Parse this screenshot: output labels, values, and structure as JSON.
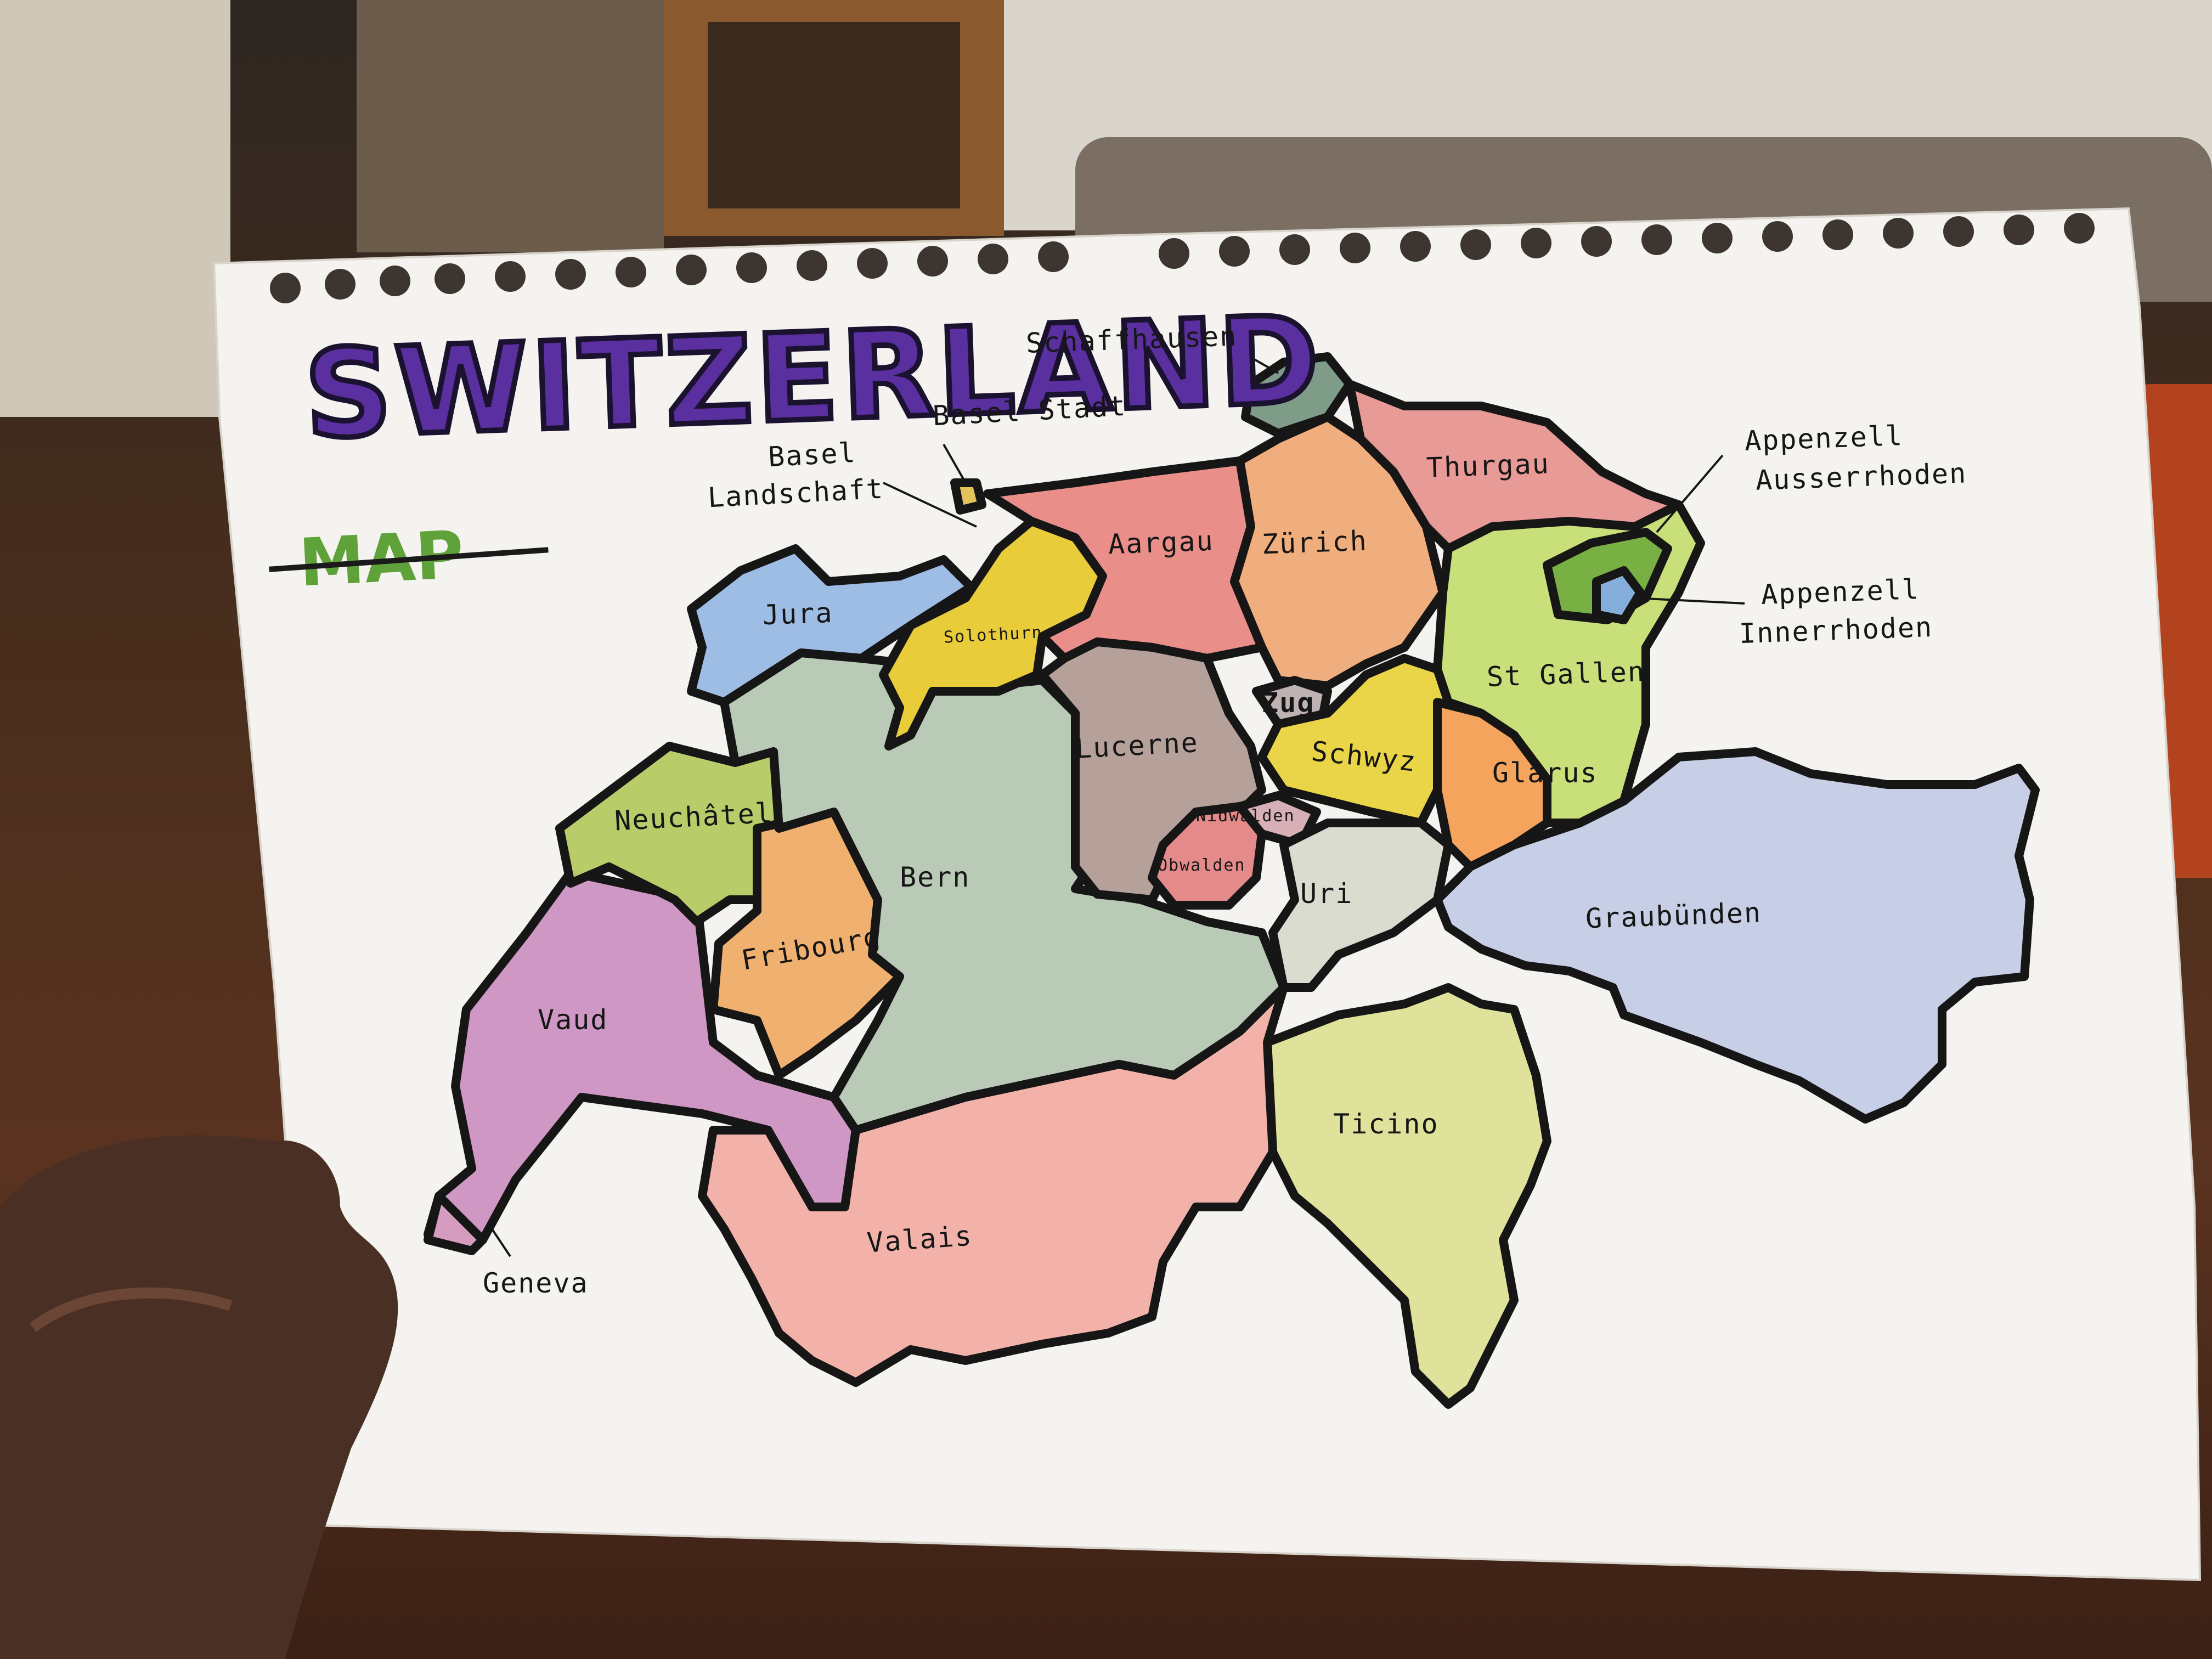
{
  "map": {
    "title": "SWITZERLAND",
    "subtitle": "MAP",
    "cantons": [
      {
        "name": "Schaffhausen",
        "color": "#7f9c88"
      },
      {
        "name": "Basel-Stadt",
        "color": "#e3c45a"
      },
      {
        "name": "Basel Landschaft",
        "color": "#e3c45a"
      },
      {
        "name": "Thurgau",
        "color": "#e79a96"
      },
      {
        "name": "Appenzell Ausserrhoden",
        "color": "#79b043"
      },
      {
        "name": "Appenzell Innerrhoden",
        "color": "#86aedd"
      },
      {
        "name": "Aargau",
        "color": "#e98e89"
      },
      {
        "name": "Zürich",
        "color": "#f0ad7e"
      },
      {
        "name": "Jura",
        "color": "#9ebde5"
      },
      {
        "name": "Solothurn",
        "color": "#e8cc3a"
      },
      {
        "name": "St Gallen",
        "color": "#c9e07a"
      },
      {
        "name": "Zug",
        "color": "#bfb2b3"
      },
      {
        "name": "Lucerne",
        "color": "#b5a19a"
      },
      {
        "name": "Schwyz",
        "color": "#ead447"
      },
      {
        "name": "Glarus",
        "color": "#f4a45c"
      },
      {
        "name": "Neuchâtel",
        "color": "#b9cc6a"
      },
      {
        "name": "Nidwalden",
        "color": "#d6b0b6"
      },
      {
        "name": "Obwalden",
        "color": "#e58a8a"
      },
      {
        "name": "Bern",
        "color": "#b9cab6"
      },
      {
        "name": "Uri",
        "color": "#d9dccf"
      },
      {
        "name": "Graubünden",
        "color": "#c7cfe6"
      },
      {
        "name": "Fribourg",
        "color": "#f0b070"
      },
      {
        "name": "Vaud",
        "color": "#cf97c3"
      },
      {
        "name": "Ticino",
        "color": "#dfe29a"
      },
      {
        "name": "Valais",
        "color": "#f2b2aa"
      },
      {
        "name": "Geneva",
        "color": "#d59cc0"
      }
    ],
    "labels": {
      "schaffhausen": "Schaffhausen",
      "basel_stadt": "Basel-Stadt",
      "basel_landschaft_1": "Basel",
      "basel_landschaft_2": "Landschaft",
      "thurgau": "Thurgau",
      "appenzell_a_1": "Appenzell",
      "appenzell_a_2": "Ausserrhoden",
      "appenzell_i_1": "Appenzell",
      "appenzell_i_2": "Innerrhoden",
      "aargau": "Aargau",
      "zurich": "Zürich",
      "jura": "Jura",
      "solothurn": "Solothurn",
      "st_gallen": "St Gallen",
      "zug": "Zug",
      "lucerne": "Lucerne",
      "schwyz": "Schwyz",
      "glarus": "Glarus",
      "neuchatel": "Neuchâtel",
      "nidwalden": "Nidwalden",
      "obwalden": "Obwalden",
      "bern": "Bern",
      "uri": "Uri",
      "graubunden": "Graubünden",
      "fribourg": "Fribourg",
      "vaud": "Vaud",
      "ticino": "Ticino",
      "valais": "Valais",
      "geneva": "Geneva"
    }
  }
}
